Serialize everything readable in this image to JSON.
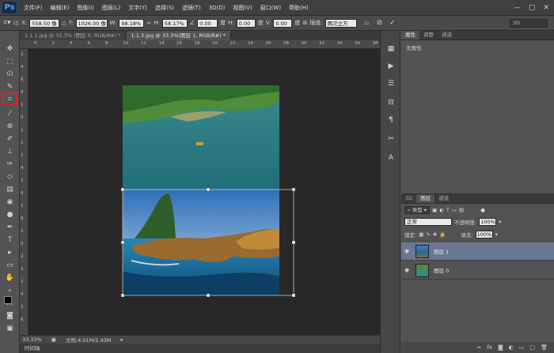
{
  "menubar": {
    "logo": "Ps",
    "items": [
      "文件(F)",
      "编辑(E)",
      "图像(I)",
      "图层(L)",
      "文字(Y)",
      "选择(S)",
      "滤镜(T)",
      "3D(D)",
      "视图(V)",
      "窗口(W)",
      "帮助(H)"
    ],
    "window_controls": [
      "—",
      "□",
      "✕"
    ]
  },
  "options": {
    "x_label": "X:",
    "x_value": "558.50 像",
    "y_label": "Y:",
    "y_value": "1026.00 像",
    "w_label": "W:",
    "w_value": "98.18%",
    "h_label": "H:",
    "h_value": "58.17%",
    "angle_value": "0.00",
    "angle_unit": "度",
    "hskew_label": "H:",
    "hskew_value": "0.00",
    "hskew_unit": "度",
    "vskew_label": "V:",
    "vskew_value": "0.00",
    "vskew_unit": "度",
    "interp_label": "插值:",
    "interp_value": "两次立方",
    "threeD_value": "3D"
  },
  "tabs": [
    {
      "label": "1.1.1.jpg @ 33.3% (图层 0, RGB/8#) *",
      "active": false
    },
    {
      "label": "1.1.3.jpg @ 33.3%(图层 1, RGB/8#) *",
      "active": true
    }
  ],
  "ruler": {
    "top": [
      "0",
      "2",
      "4",
      "6",
      "8",
      "10",
      "12",
      "14",
      "16",
      "18",
      "20",
      "22",
      "24",
      "26",
      "28",
      "30",
      "32",
      "34",
      "36",
      "38"
    ],
    "left": [
      "2",
      "4",
      "6",
      "8",
      "1",
      "0",
      "1",
      "2",
      "1",
      "4",
      "1",
      "6",
      "1",
      "8",
      "2",
      "0",
      "2",
      "2",
      "2",
      "4",
      "2",
      "6"
    ]
  },
  "status": {
    "zoom": "33.33%",
    "doc": "文档:4.01M/2.43M"
  },
  "timeline": "时间轴",
  "props": {
    "tabs": [
      "属性",
      "调整",
      "通道"
    ],
    "content": "无属性"
  },
  "layers_panel": {
    "tabs": [
      "3D",
      "图层",
      "通道"
    ],
    "filter": "类型",
    "blend_mode": "正常",
    "opacity_label": "不透明度:",
    "opacity_value": "100%",
    "lock_label": "锁定:",
    "fill_label": "填充:",
    "fill_value": "100%",
    "layers": [
      {
        "name": "图层 1",
        "selected": true
      },
      {
        "name": "图层 0",
        "selected": false
      }
    ]
  }
}
